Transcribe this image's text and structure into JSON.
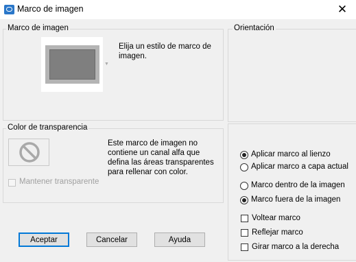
{
  "window": {
    "title": "Marco de imagen",
    "close_glyph": "✕"
  },
  "frame_group": {
    "label": "Marco de imagen",
    "description_line1": "Elija un estilo de marco de",
    "description_line2": "imagen."
  },
  "transparency_group": {
    "label": "Color de transparencia",
    "description_line1": "Este marco de imagen no",
    "description_line2": "contiene un canal alfa que",
    "description_line3": "defina las áreas transparentes",
    "description_line4": "para rellenar con color.",
    "keep_transparent_label": "Mantener transparente",
    "keep_transparent_checked": false,
    "keep_transparent_enabled": false
  },
  "orientation_group": {
    "label": "Orientación",
    "apply_canvas_label": "Aplicar marco al lienzo",
    "apply_layer_label": "Aplicar marco a capa actual",
    "apply_target": "canvas",
    "frame_inside_label": "Marco dentro de la imagen",
    "frame_outside_label": "Marco fuera de la imagen",
    "frame_position": "outside",
    "flip_label": "Voltear marco",
    "flip_checked": false,
    "mirror_label": "Reflejar marco",
    "mirror_checked": false,
    "rotate_label": "Girar marco a la derecha",
    "rotate_checked": false
  },
  "buttons": {
    "ok": "Aceptar",
    "cancel": "Cancelar",
    "help": "Ayuda"
  },
  "colors": {
    "accent": "#0078d7",
    "frame_border": "#b4b4b4",
    "frame_fill": "#7f7f7f",
    "icon_blue": "#2a77c9"
  },
  "icons": {
    "app": "picture-frame-icon",
    "no_transparency": "no-sign-icon",
    "dropdown": "triangle-down-icon"
  }
}
